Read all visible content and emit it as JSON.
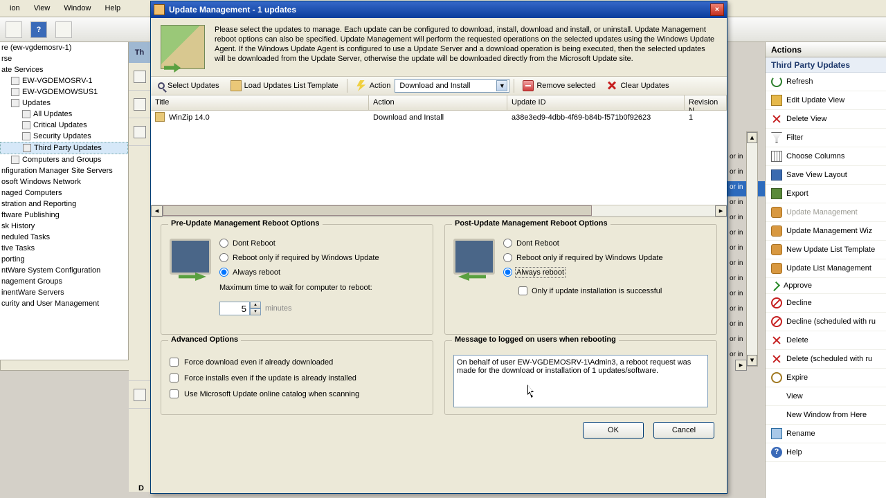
{
  "menubar": {
    "items": [
      "ion",
      "View",
      "Window",
      "Help"
    ]
  },
  "tree": {
    "root": "re (ew-vgdemosrv-1)",
    "items": [
      {
        "label": "rse",
        "lvl": 0
      },
      {
        "label": "ate Services",
        "lvl": 0
      },
      {
        "label": "EW-VGDEMOSRV-1",
        "lvl": 1
      },
      {
        "label": "EW-VGDEMOWSUS1",
        "lvl": 1
      },
      {
        "label": "Updates",
        "lvl": 1,
        "expand": true
      },
      {
        "label": "All Updates",
        "lvl": 2
      },
      {
        "label": "Critical Updates",
        "lvl": 2
      },
      {
        "label": "Security Updates",
        "lvl": 2
      },
      {
        "label": "Third Party Updates",
        "lvl": 2,
        "sel": true
      },
      {
        "label": "Computers and Groups",
        "lvl": 1
      },
      {
        "label": "nfiguration Manager Site Servers",
        "lvl": 0
      },
      {
        "label": "osoft Windows Network",
        "lvl": 0
      },
      {
        "label": "naged Computers",
        "lvl": 0
      },
      {
        "label": "stration and Reporting",
        "lvl": 0
      },
      {
        "label": "ftware Publishing",
        "lvl": 0
      },
      {
        "label": "sk History",
        "lvl": 0
      },
      {
        "label": "neduled Tasks",
        "lvl": 0
      },
      {
        "label": "tive Tasks",
        "lvl": 0
      },
      {
        "label": "porting",
        "lvl": 0
      },
      {
        "label": "ntWare System Configuration",
        "lvl": 0
      },
      {
        "label": "nagement Groups",
        "lvl": 0
      },
      {
        "label": "inentWare Servers",
        "lvl": 0
      },
      {
        "label": "curity and User Management",
        "lvl": 0
      }
    ]
  },
  "midstrip": {
    "header": "Th"
  },
  "bgrows": [
    "or in",
    "or in",
    "or in",
    "or in",
    "or in",
    "or in",
    "or in",
    "or in",
    "or in",
    "or in",
    "or in",
    "or in",
    "or in",
    "or in"
  ],
  "actions": {
    "header": "Actions",
    "subheader": "Third Party Updates",
    "items": [
      {
        "label": "Refresh",
        "icon": "refresh"
      },
      {
        "label": "Edit Update View",
        "icon": "edit"
      },
      {
        "label": "Delete View",
        "icon": "delx"
      },
      {
        "label": "Filter",
        "icon": "filter"
      },
      {
        "label": "Choose Columns",
        "icon": "cols"
      },
      {
        "label": "Save View Layout",
        "icon": "save"
      },
      {
        "label": "Export",
        "icon": "export"
      },
      {
        "label": "Update Management",
        "icon": "um",
        "disabled": true
      },
      {
        "label": "Update Management Wiz",
        "icon": "um"
      },
      {
        "label": "New Update List Template",
        "icon": "um"
      },
      {
        "label": "Update List Management",
        "icon": "um"
      },
      {
        "label": "Approve",
        "icon": "approve"
      },
      {
        "label": "Decline",
        "icon": "decline"
      },
      {
        "label": "Decline (scheduled with ru",
        "icon": "decline"
      },
      {
        "label": "Delete",
        "icon": "delx"
      },
      {
        "label": "Delete (scheduled with ru",
        "icon": "delx"
      },
      {
        "label": "Expire",
        "icon": "expire"
      },
      {
        "label": "View",
        "icon": ""
      },
      {
        "label": "New Window from Here",
        "icon": ""
      },
      {
        "label": "Rename",
        "icon": "rename"
      },
      {
        "label": "Help",
        "icon": "help"
      }
    ]
  },
  "dialog": {
    "title": "Update Management - 1 updates",
    "info": "Please select the updates to manage. Each update can be configured to download, install, download and install, or uninstall. Update Management reboot options can also be specified. Update Management will perform the requested operations on the selected updates using the Windows Update Agent. If the Windows Update Agent is configured to use a Update Server and a download operation is being executed, then the selected updates will be downloaded from the Update Server, otherwise the update will be downloaded directly from the Microsoft Update site.",
    "toolbar": {
      "select": "Select Updates",
      "load": "Load Updates List Template",
      "action_lbl": "Action",
      "action_value": "Download and Install",
      "remove": "Remove selected",
      "clear": "Clear Updates"
    },
    "grid": {
      "headers": {
        "title": "Title",
        "action": "Action",
        "uid": "Update ID",
        "rev": "Revision N"
      },
      "rows": [
        {
          "title": "WinZip 14.0",
          "action": "Download and Install",
          "uid": "a38e3ed9-4dbb-4f69-b84b-f571b0f92623",
          "rev": "1"
        }
      ]
    },
    "pre": {
      "legend": "Pre-Update Management Reboot Options",
      "r1": "Dont Reboot",
      "r2": "Reboot only if required by Windows Update",
      "r3": "Always reboot",
      "wait_label": "Maximum time to wait for computer to reboot:",
      "wait_value": "5",
      "wait_unit": "minutes"
    },
    "post": {
      "legend": "Post-Update Management Reboot Options",
      "r1": "Dont Reboot",
      "r2": "Reboot only if required by Windows Update",
      "r3": "Always reboot",
      "chk": "Only if update installation is successful"
    },
    "adv": {
      "legend": "Advanced Options",
      "c1": "Force download even if already downloaded",
      "c2": "Force installs even if the update is already installed",
      "c3": "Use Microsoft Update online catalog when scanning"
    },
    "msg": {
      "legend": "Message to logged on users when rebooting",
      "text": "On behalf of user EW-VGDEMOSRV-1\\Admin3, a reboot request was made for the download or installation of 1 updates/software."
    },
    "buttons": {
      "ok": "OK",
      "cancel": "Cancel"
    }
  },
  "footer_d": "D"
}
